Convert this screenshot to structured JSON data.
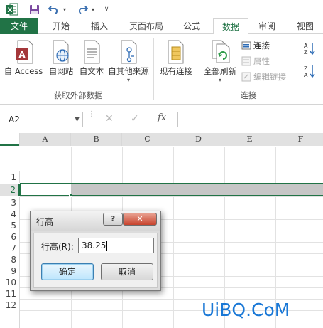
{
  "quick_access": {
    "save_icon": "save-icon",
    "undo_icon": "undo-icon",
    "redo_icon": "redo-icon"
  },
  "tabs": [
    {
      "label": "文件",
      "state": "file"
    },
    {
      "label": "开始"
    },
    {
      "label": "插入"
    },
    {
      "label": "页面布局"
    },
    {
      "label": "公式"
    },
    {
      "label": "数据",
      "state": "active"
    },
    {
      "label": "审阅"
    },
    {
      "label": "视图"
    }
  ],
  "ribbon": {
    "external_data": {
      "group_label": "获取外部数据",
      "buttons": [
        {
          "label": "自 Access",
          "icon": "access-icon"
        },
        {
          "label": "自网站",
          "icon": "web-icon"
        },
        {
          "label": "自文本",
          "icon": "text-file-icon"
        },
        {
          "label": "自其他来源",
          "icon": "other-sources-icon"
        }
      ]
    },
    "existing": {
      "label": "现有连接",
      "icon": "existing-connections-icon"
    },
    "connections": {
      "group_label": "连接",
      "refresh_all": "全部刷新",
      "connections": "连接",
      "properties": "属性",
      "edit_links": "编辑链接"
    },
    "sort": {
      "az": "A↓Z",
      "za": "Z↓A"
    }
  },
  "formula_bar": {
    "name_box": "A2",
    "fx": "fx",
    "cancel_glyph": "✕",
    "enter_glyph": "✓",
    "value": ""
  },
  "sheet": {
    "columns": [
      "A",
      "B",
      "C",
      "D",
      "E",
      "F"
    ],
    "rows": [
      "1",
      "2",
      "3",
      "4",
      "5",
      "6",
      "7",
      "8",
      "9",
      "10",
      "11",
      "12"
    ],
    "active_cell": "A2"
  },
  "dialog": {
    "title": "行高",
    "help": "?",
    "close": "✕",
    "field_label": "行高(R):",
    "value": "38.25",
    "ok": "确定",
    "cancel": "取消"
  },
  "watermark": "UiBQ.CoM",
  "colors": {
    "excel_green": "#217346",
    "watermark_blue": "#1a78d6",
    "selection_gray": "#c6c6c6"
  }
}
